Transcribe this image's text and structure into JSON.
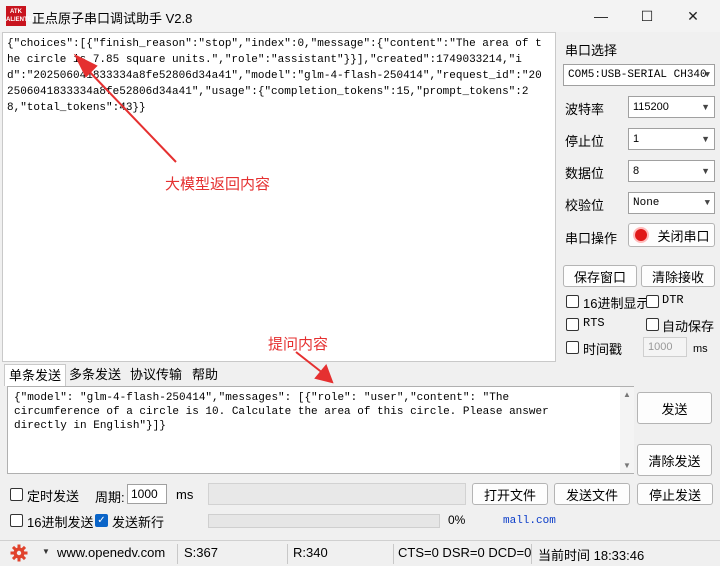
{
  "window": {
    "title": "正点原子串口调试助手 V2.8",
    "logo_text": "ATK ALIENTEK",
    "minimize_label": "—",
    "maximize_label": "☐",
    "close_label": "✕"
  },
  "receive": {
    "text": "{\"choices\":[{\"finish_reason\":\"stop\",\"index\":0,\"message\":{\"content\":\"The area of the circle is 7.85 square units.\",\"role\":\"assistant\"}}],\"created\":1749033214,\"id\":\"202506041833334a8fe52806d34a41\",\"model\":\"glm-4-flash-250414\",\"request_id\":\"202506041833334a8fe52806d34a41\",\"usage\":{\"completion_tokens\":15,\"prompt_tokens\":28,\"total_tokens\":43}}",
    "annotation": "大模型返回内容"
  },
  "send_annotation": "提问内容",
  "serial": {
    "port_label": "串口选择",
    "port_value": "COM5:USB-SERIAL CH340",
    "baud_label": "波特率",
    "baud_value": "115200",
    "stop_label": "停止位",
    "stop_value": "1",
    "data_label": "数据位",
    "data_value": "8",
    "parity_label": "校验位",
    "parity_value": "None",
    "op_label": "串口操作",
    "toggle_label": "关闭串口"
  },
  "controls": {
    "save_window": "保存窗口",
    "clear_receive": "清除接收",
    "hex_display": "16进制显示",
    "dtr": "DTR",
    "rts": "RTS",
    "auto_save": "自动保存",
    "timestamp": "时间戳",
    "timestamp_ms": "1000",
    "ms": "ms"
  },
  "tabs": [
    "单条发送",
    "多条发送",
    "协议传输",
    "帮助"
  ],
  "send": {
    "text": "{\"model\": \"glm-4-flash-250414\",\"messages\": [{\"role\": \"user\",\"content\": \"The circumference of a circle is 10. Calculate the area of this circle. Please answer directly in English\"}]}",
    "send_button": "发送",
    "clear_button": "清除发送"
  },
  "bottom": {
    "timed_send": "定时发送",
    "period_label": "周期:",
    "period_value": "1000",
    "ms": "ms",
    "open_file": "打开文件",
    "send_file": "发送文件",
    "stop_send": "停止发送",
    "hex_send": "16进制发送",
    "send_newline": "发送新行",
    "progress_pct": "0%",
    "progress_value": 0,
    "link_text": "mall.com"
  },
  "status": {
    "website": "www.openedv.com",
    "sent": "S:367",
    "received": "R:340",
    "lines": "CTS=0 DSR=0 DCD=0",
    "time": "当前时间 18:33:46"
  },
  "colors": {
    "annotation": "#e53030",
    "accent": "#0a64c8",
    "link": "#0a3cc8",
    "logo": "#c8141e"
  }
}
